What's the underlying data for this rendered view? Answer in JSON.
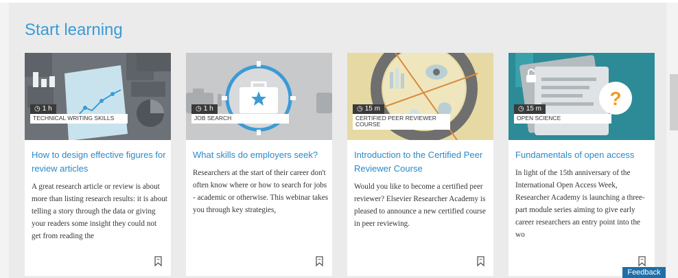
{
  "section": {
    "title": "Start learning"
  },
  "cards": [
    {
      "duration": "1 h",
      "category": "TECHNICAL WRITING SKILLS",
      "title": "How to design effective figures for review articles",
      "description": "A great research article or review is about more than listing research results: it is about telling a story through the data or giving your readers some insight they could not get from reading the"
    },
    {
      "duration": "1 h",
      "category": "JOB SEARCH",
      "title": "What skills do employers seek?",
      "description": "Researchers at the start of their career don't often know where or how to search for jobs - academic or otherwise. This webinar takes you through key strategies,"
    },
    {
      "duration": "15 m",
      "category": "CERTIFIED PEER REVIEWER COURSE",
      "title": "Introduction to the Certified Peer Reviewer Course",
      "description": "Would you like to become a certified peer reviewer? Elsevier Researcher Academy is pleased to announce a new certified course in peer reviewing."
    },
    {
      "duration": "15 m",
      "category": "OPEN SCIENCE",
      "title": "Fundamentals of open access",
      "description": "In light of the 15th anniversary of the International Open Access Week, Researcher Academy is launching a three-part module series aiming to give early career researchers an entry point into the wo"
    }
  ],
  "feedback": {
    "label": "Feedback"
  },
  "colors": {
    "accent": "#3a9bd6",
    "feedback_bg": "#1e6fa9"
  },
  "icons": {
    "duration": "clock-icon",
    "bookmark": "bookmark-icon"
  }
}
